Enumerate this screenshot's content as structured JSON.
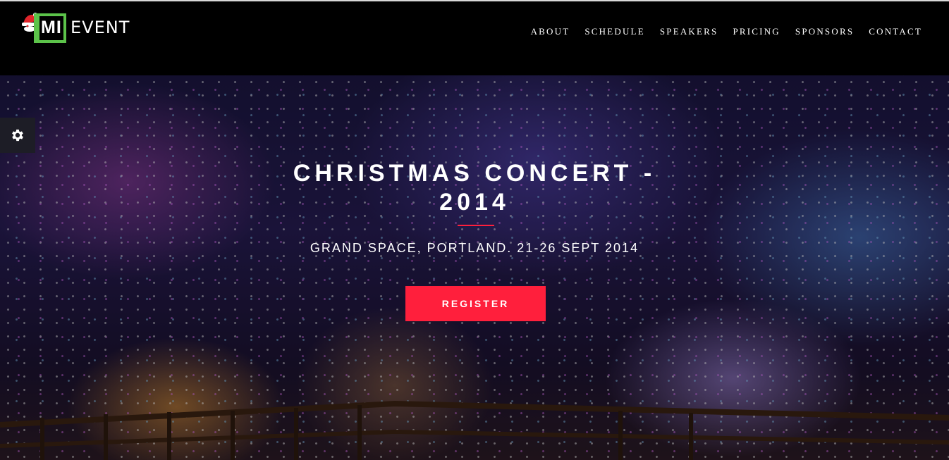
{
  "logo": {
    "mi": "MI",
    "event": "EVENT",
    "accent_color": "#5cc34a"
  },
  "nav": {
    "items": [
      "ABOUT",
      "SCHEDULE",
      "SPEAKERS",
      "PRICING",
      "SPONSORS",
      "CONTACT"
    ]
  },
  "settings": {
    "icon": "gear-icon"
  },
  "hero": {
    "title": "CHRISTMAS CONCERT - 2014",
    "subtitle": "GRAND SPACE, PORTLAND. 21-26 SEPT 2014",
    "register_label": "REGISTER",
    "accent_color": "#ff1f3c"
  }
}
